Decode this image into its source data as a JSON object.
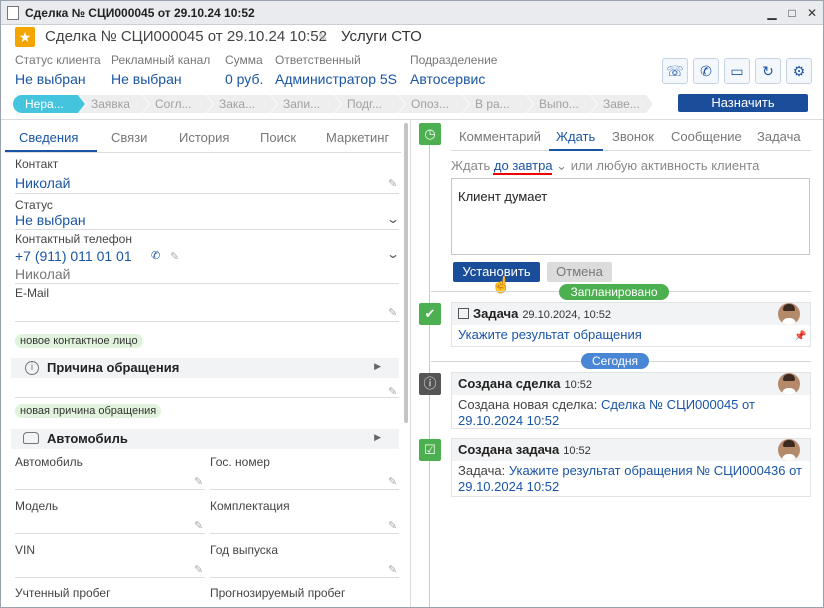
{
  "window": {
    "title": "Сделка № СЦИ000045 от 29.10.24 10:52"
  },
  "header": {
    "title": "Сделка № СЦИ000045 от 29.10.24 10:52",
    "service": "Услуги СТО"
  },
  "fields": [
    {
      "label": "Статус клиента",
      "value": "Не выбран"
    },
    {
      "label": "Рекламный канал",
      "value": "Не выбран"
    },
    {
      "label": "Сумма",
      "value": "0 руб."
    },
    {
      "label": "Ответственный",
      "value": "Администратор 5S"
    },
    {
      "label": "Подразделение",
      "value": "Автосервис"
    }
  ],
  "stages": [
    "Нера...",
    "Заявка",
    "Согл...",
    "Зака...",
    "Запи...",
    "Подг...",
    "Опоз...",
    "В ра...",
    "Выпо...",
    "Заве..."
  ],
  "assign_label": "Назначить",
  "left_tabs": [
    "Сведения",
    "Связи",
    "История",
    "Поиск",
    "Маркетинг"
  ],
  "details": {
    "contact_label": "Контакт",
    "contact_value": "Николай",
    "status_label": "Статус",
    "status_value": "Не выбран",
    "phone_label": "Контактный телефон",
    "phone_value": "+7 (911) 011 01 01",
    "phone_name": "Николай",
    "email_label": "E-Mail",
    "tag_contact": "новое контактное лицо",
    "reason_title": "Причина обращения",
    "tag_reason": "новая причина обращения",
    "car_title": "Автомобиль",
    "car_fields": [
      "Автомобиль",
      "Гос. номер",
      "Модель",
      "Комплектация",
      "VIN",
      "Год выпуска",
      "Учтенный пробег",
      "Прогнозируемый пробег"
    ]
  },
  "right_tabs": [
    "Комментарий",
    "Ждать",
    "Звонок",
    "Сообщение",
    "Задача"
  ],
  "wait": {
    "prefix": "Ждать",
    "link": "до завтра",
    "suffix": "или любую активность клиента",
    "text": "Клиент думает",
    "set_label": "Установить",
    "cancel_label": "Отмена"
  },
  "timeline": {
    "planned_label": "Запланировано",
    "today_label": "Сегодня",
    "task": {
      "title": "Задача",
      "time": "29.10.2024, 10:52",
      "link": "Укажите результат обращения"
    },
    "deal": {
      "title": "Создана сделка",
      "time": "10:52",
      "text": "Создана новая сделка:",
      "link": "Сделка № СЦИ000045 от 29.10.2024 10:52"
    },
    "created_task": {
      "title": "Создана задача",
      "time": "10:52",
      "text": "Задача:",
      "link": "Укажите результат обращения № СЦИ000436 от 29.10.2024 10:52"
    }
  },
  "colors": {
    "accent": "#1a55a5",
    "primary_button": "#1a4d9a",
    "stage_active": "#45c4de",
    "timeline_green": "#4caf50"
  }
}
